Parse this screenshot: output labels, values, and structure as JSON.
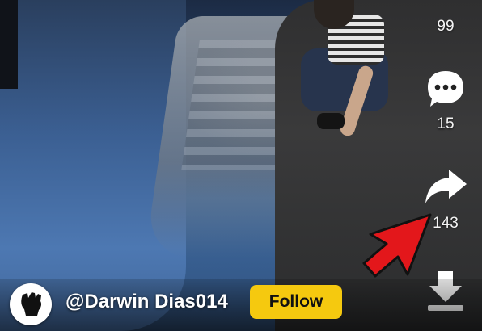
{
  "right_rail": {
    "likes_count": "99",
    "comments_count": "15",
    "shares_count": "143"
  },
  "author": {
    "username": "@Darwin Dias014",
    "avatar_icon": "raised-fist-icon"
  },
  "actions": {
    "follow_label": "Follow"
  },
  "icons": {
    "comment": "comment-bubble-icon",
    "share": "share-arrow-icon",
    "download": "download-icon",
    "annotation": "red-arrow-icon"
  },
  "colors": {
    "follow_button": "#f5c90f",
    "annotation_arrow": "#e3171b",
    "icon_white": "#ffffff"
  }
}
